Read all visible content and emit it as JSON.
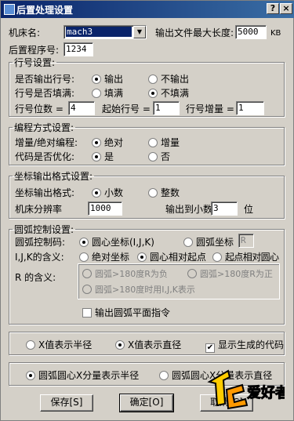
{
  "window": {
    "title": "后置处理设置",
    "help": "?",
    "close": "×"
  },
  "top": {
    "machine_label": "机床名:",
    "machine_value": "mach3",
    "maxlen_label": "输出文件最大长度:",
    "maxlen_value": "5000",
    "maxlen_unit": "KB",
    "program_label": "后置程序号:",
    "program_value": "1234"
  },
  "line": {
    "legend": "行号设置:",
    "output_label": "是否输出行号:",
    "output_opts": [
      "输出",
      "不输出"
    ],
    "output_selected": 0,
    "fill_label": "行号是否填满:",
    "fill_opts": [
      "填满",
      "不填满"
    ],
    "fill_selected": 1,
    "digits_label": "行号位数 =",
    "digits_value": "4",
    "start_label": "起始行号 =",
    "start_value": "1",
    "incr_label": "行号增量 =",
    "incr_value": "1"
  },
  "coding": {
    "legend": "编程方式设置:",
    "mode_label": "增量/绝对编程:",
    "mode_opts": [
      "绝对",
      "增量"
    ],
    "mode_selected": 0,
    "opt_label": "代码是否优化:",
    "opt_opts": [
      "是",
      "否"
    ],
    "opt_selected": 0
  },
  "coord": {
    "legend": "坐标输出格式设置:",
    "fmt_label": "坐标输出格式:",
    "fmt_opts": [
      "小数",
      "整数"
    ],
    "fmt_selected": 0,
    "res_label": "机床分辨率",
    "res_value": "1000",
    "dec_label": "输出到小数点后",
    "dec_value": "3",
    "dec_unit": "位"
  },
  "arc": {
    "legend": "圆弧控制设置:",
    "code_label": "圆弧控制码:",
    "code_opts": [
      "圆心坐标(I,J,K)",
      "圆弧坐标"
    ],
    "code_selected": 0,
    "r_field": "R",
    "ijk_label": "I,J,K的含义:",
    "ijk_opts": [
      "绝对坐标",
      "圆心相对起点",
      "起点相对圆心"
    ],
    "ijk_selected": 1,
    "r_label": "R 的含义:",
    "r_opts": [
      "圆弧>180度R为负",
      "圆弧>180度R为正",
      "圆弧>180度时用I,J,K表示"
    ],
    "plane_label": "输出圆弧平面指令",
    "plane_checked": false
  },
  "xaxis": {
    "opts": [
      "X值表示半径",
      "X值表示直径"
    ],
    "selected": 1,
    "show_label": "显示生成的代码",
    "show_checked": true
  },
  "center": {
    "opts": [
      "圆弧圆心X分量表示半径",
      "圆弧圆心X分量表示直径"
    ],
    "selected": 0
  },
  "buttons": {
    "save": "保存[S]",
    "ok": "确定[O]",
    "cancel": "取消[C]"
  },
  "watermark": {
    "text": "爱好者"
  },
  "colors": {
    "title_bar": "#0a246a",
    "face": "#d4d0c8"
  }
}
